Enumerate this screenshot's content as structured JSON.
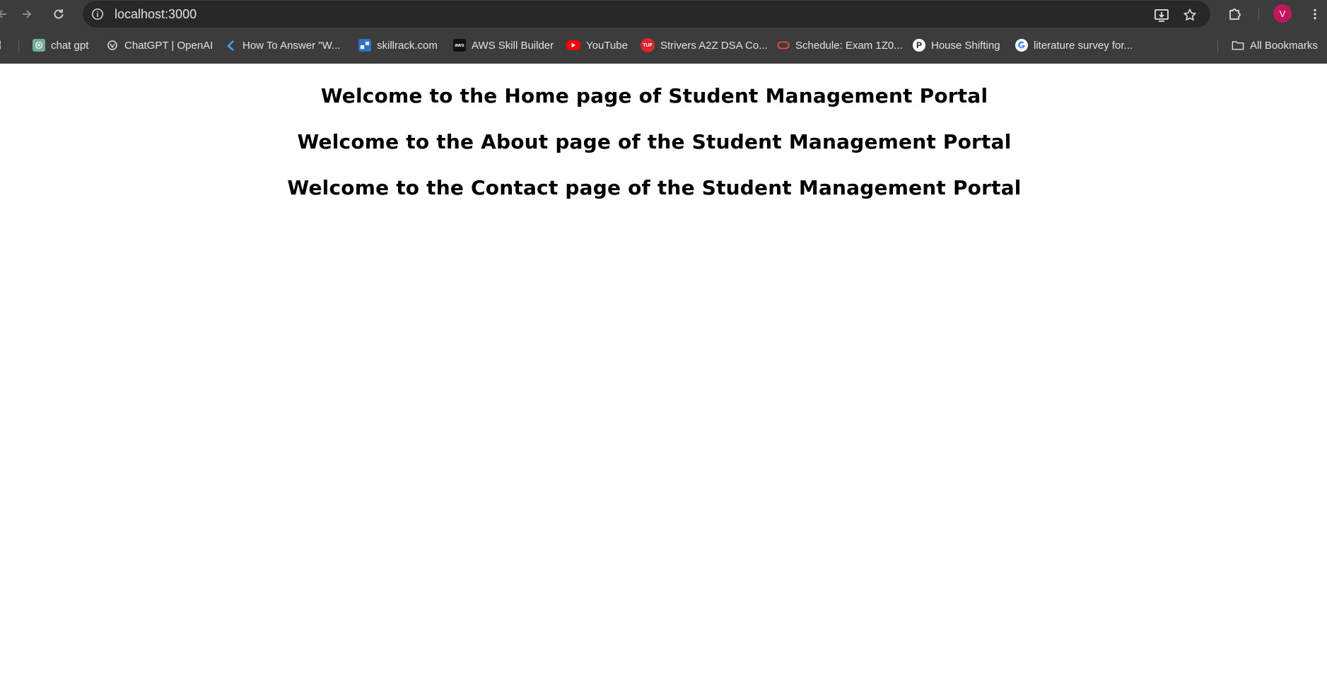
{
  "browser": {
    "url": "localhost:3000",
    "profile_initial": "V",
    "bookmarks": [
      {
        "label": "chat gpt",
        "icon": "chatgpt-icon"
      },
      {
        "label": "ChatGPT | OpenAI",
        "icon": "openai-icon"
      },
      {
        "label": "How To Answer \"W...",
        "icon": "kotlin-icon"
      },
      {
        "label": "skillrack.com",
        "icon": "skillrack-icon"
      },
      {
        "label": "AWS Skill Builder",
        "icon": "aws-icon"
      },
      {
        "label": "YouTube",
        "icon": "youtube-icon"
      },
      {
        "label": "Strivers A2Z DSA Co...",
        "icon": "tuf-icon"
      },
      {
        "label": "Schedule: Exam 1Z0...",
        "icon": "oracle-icon"
      },
      {
        "label": "House Shifting",
        "icon": "p-icon"
      },
      {
        "label": "literature survey for...",
        "icon": "google-icon"
      }
    ],
    "all_bookmarks_label": "All Bookmarks",
    "colors": {
      "toolbar": "#3c3c3c",
      "omnibox": "#282828",
      "avatar": "#c2185b"
    }
  },
  "page": {
    "headings": [
      "Welcome to the Home page of Student Management Portal",
      "Welcome to the About page of the Student Management Portal",
      "Welcome to the Contact page of the Student Management Portal"
    ]
  }
}
